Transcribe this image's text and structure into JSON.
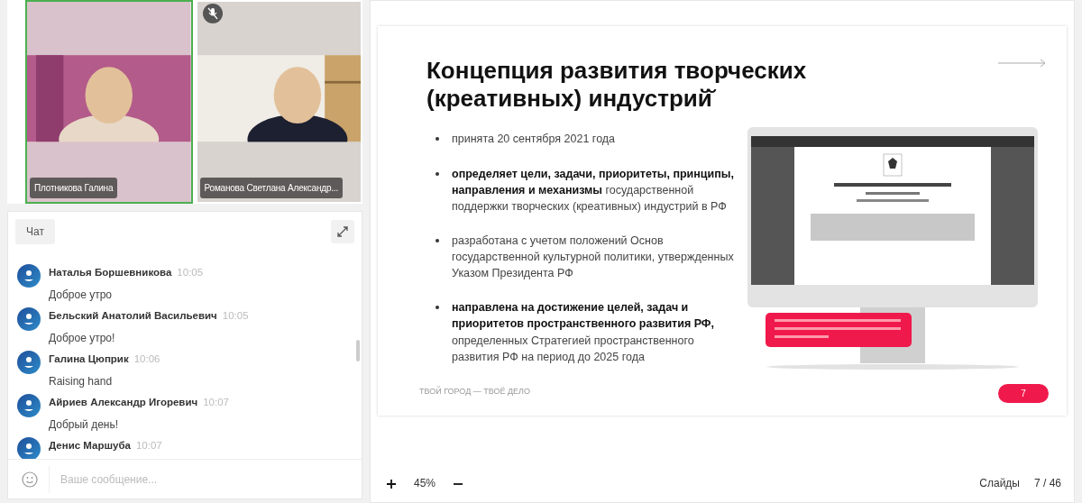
{
  "videos": [
    {
      "name": "Плотникова Галина",
      "speaking": true,
      "muted": false
    },
    {
      "name": "Романова Светлана Александр...",
      "speaking": false,
      "muted": true
    }
  ],
  "chat": {
    "tab": "Чат",
    "messages": [
      {
        "author": "Наталья Боршевникова",
        "time": "10:05",
        "text": "Доброе утро"
      },
      {
        "author": "Бельский Анатолий Васильевич",
        "time": "10:05",
        "text": "Доброе утро!"
      },
      {
        "author": "Галина Цюприк",
        "time": "10:06",
        "text": "Raising hand"
      },
      {
        "author": "Айриев Александр Игоревич",
        "time": "10:07",
        "text": "Добрый день!"
      },
      {
        "author": "Денис Маршуба",
        "time": "10:07"
      }
    ],
    "input": {
      "placeholder": "Ваше сообщение..."
    }
  },
  "slide": {
    "title": "Концепция развития творческих (креативных) индустрий̆",
    "bullets": [
      "принята 20 сентября 2021 года",
      "**определяет цели, задачи, приоритеты, принципы, направления и механизмы** государственной поддержки творческих (креативных) индустрий в РФ",
      "разработана с учетом положений Основ государственной культурной политики, утвержденных Указом Президента РФ",
      "**направлена на достижение целей, задач и приоритетов пространственного развития РФ,** определенных Стратегией пространственного развития РФ на период до 2025 года"
    ],
    "monitor": {
      "kind": "picture"
    },
    "footer": "ТВОЙ ГОРОД — ТВОЁ ДЕЛО",
    "page": "7"
  },
  "toolbar": {
    "zoom": "45%",
    "slides_label": "Слайды",
    "slides_count": "7 / 46"
  }
}
